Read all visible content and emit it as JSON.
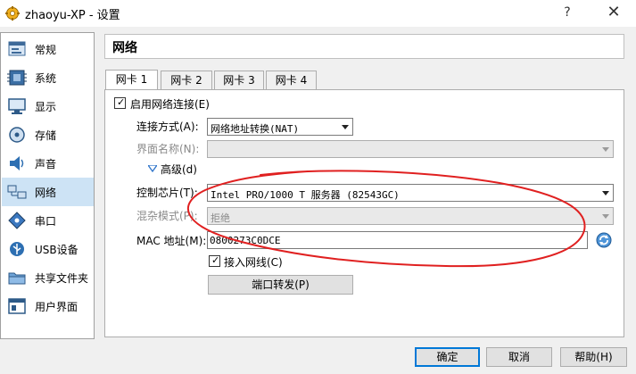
{
  "window": {
    "title": "zhaoyu-XP - 设置",
    "help_glyph": "?",
    "close_glyph": "✕"
  },
  "sidebar": {
    "items": [
      {
        "label": "常规",
        "icon": "general-icon"
      },
      {
        "label": "系统",
        "icon": "chip-icon"
      },
      {
        "label": "显示",
        "icon": "monitor-icon"
      },
      {
        "label": "存储",
        "icon": "disk-icon"
      },
      {
        "label": "声音",
        "icon": "speaker-icon"
      },
      {
        "label": "网络",
        "icon": "network-icon",
        "selected": true
      },
      {
        "label": "串口",
        "icon": "serial-port-icon"
      },
      {
        "label": "USB设备",
        "icon": "usb-icon"
      },
      {
        "label": "共享文件夹",
        "icon": "folder-icon"
      },
      {
        "label": "用户界面",
        "icon": "ui-icon"
      }
    ]
  },
  "section": {
    "title": "网络"
  },
  "tabs": [
    {
      "label": "网卡 1",
      "active": true
    },
    {
      "label": "网卡 2"
    },
    {
      "label": "网卡 3"
    },
    {
      "label": "网卡 4"
    }
  ],
  "adapter": {
    "enable_label": "启用网络连接(E)",
    "enable_checked": true,
    "attached_label": "连接方式(A):",
    "attached_value": "网络地址转换(NAT)",
    "name_label": "界面名称(N):",
    "name_value": "",
    "advanced_label": "高级(d)",
    "chip_label": "控制芯片(T):",
    "chip_value": "Intel PRO/1000 T 服务器 (82543GC)",
    "promisc_label": "混杂模式(P):",
    "promisc_value": "拒绝",
    "mac_label": "MAC 地址(M):",
    "mac_value": "0800273C0DCE",
    "cable_label": "接入网线(C)",
    "cable_checked": true,
    "port_forward_label": "端口转发(P)"
  },
  "buttons": {
    "ok": "确定",
    "cancel": "取消",
    "help": "帮助(H)"
  },
  "colors": {
    "selection": "#cde3f5",
    "annotation": "#e02020",
    "default_button_border": "#0078d7"
  }
}
